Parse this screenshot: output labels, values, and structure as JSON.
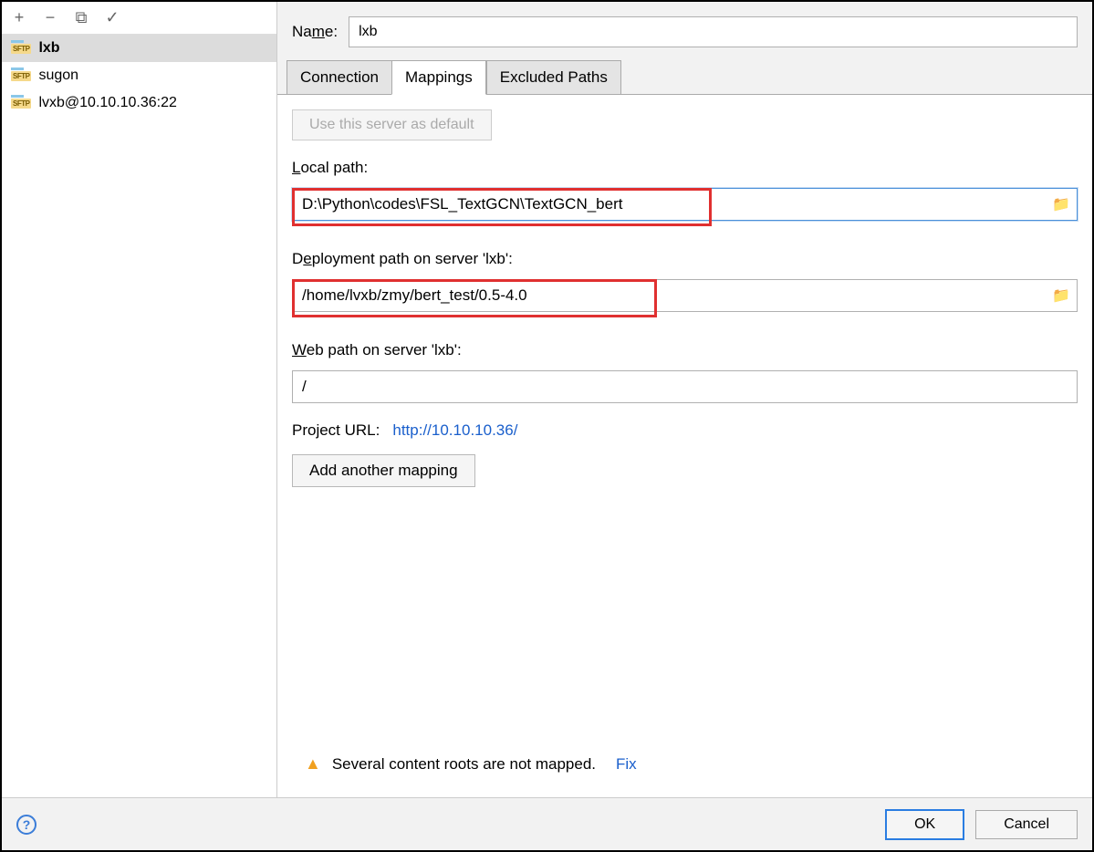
{
  "toolbar": {
    "add": "+",
    "remove": "−",
    "copy": "⧉",
    "check": "✓"
  },
  "servers": [
    {
      "protocol": "SFTP",
      "name": "lxb",
      "selected": true
    },
    {
      "protocol": "SFTP",
      "name": "sugon",
      "selected": false
    },
    {
      "protocol": "SFTP",
      "name": "lvxb@10.10.10.36:22",
      "selected": false
    }
  ],
  "name_label": "Name:",
  "name_value": "lxb",
  "tabs": {
    "connection": "Connection",
    "mappings": "Mappings",
    "excluded": "Excluded Paths"
  },
  "default_btn": "Use this server as default",
  "local_path_label": "Local path:",
  "local_path_value": "D:\\Python\\codes\\FSL_TextGCN\\TextGCN_bert",
  "deploy_path_label": "Deployment path on server 'lxb':",
  "deploy_path_value": "/home/lvxb/zmy/bert_test/0.5-4.0",
  "web_path_label": "Web path on server 'lxb':",
  "web_path_value": "/",
  "project_url_label": "Project URL:",
  "project_url_value": "http://10.10.10.36/",
  "add_mapping_btn": "Add another mapping",
  "warning_text": "Several content roots are not mapped.",
  "fix_label": "Fix",
  "ok_label": "OK",
  "cancel_label": "Cancel"
}
